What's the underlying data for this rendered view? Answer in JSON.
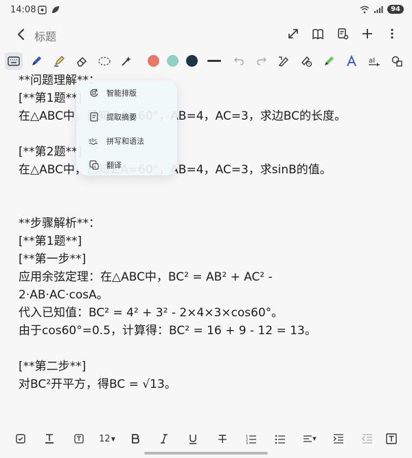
{
  "status_bar": {
    "time": "14:08",
    "battery": "94"
  },
  "header": {
    "title": "标题"
  },
  "toolbar": {
    "colors": [
      "#e87766",
      "#8fd0c6",
      "#1e3545"
    ]
  },
  "menu": {
    "items": [
      {
        "label": "智能排版",
        "icon": "smart-layout-icon"
      },
      {
        "label": "提取摘要",
        "icon": "summary-icon"
      },
      {
        "label": "拼写和语法",
        "icon": "spellcheck-icon"
      },
      {
        "label": "翻译",
        "icon": "translate-icon"
      }
    ]
  },
  "content": {
    "lines": [
      "**问题理解**：",
      "[**第1题**]",
      "在△ABC中，已知∠A=60°，AB=4，AC=3，求边BC的长度。",
      "",
      "[**第2题**]",
      "在△ABC中，已知∠A=60°，AB=4，AC=3，求sinB的值。",
      "",
      "",
      "**步骤解析**：",
      "[**第1题**]",
      "[**第一步**]",
      "应用余弦定理：在△ABC中，BC² = AB² + AC² -",
      "2·AB·AC·cosA。",
      "代入已知值：BC² = 4² + 3² - 2×4×3×cos60°。",
      "由于cos60°=0.5，计算得：BC² = 16 + 9 - 12 = 13。",
      "",
      "[**第二步**]",
      "对BC²开平方，得BC = √13。"
    ]
  },
  "format_toolbar": {
    "font_size": "12"
  }
}
